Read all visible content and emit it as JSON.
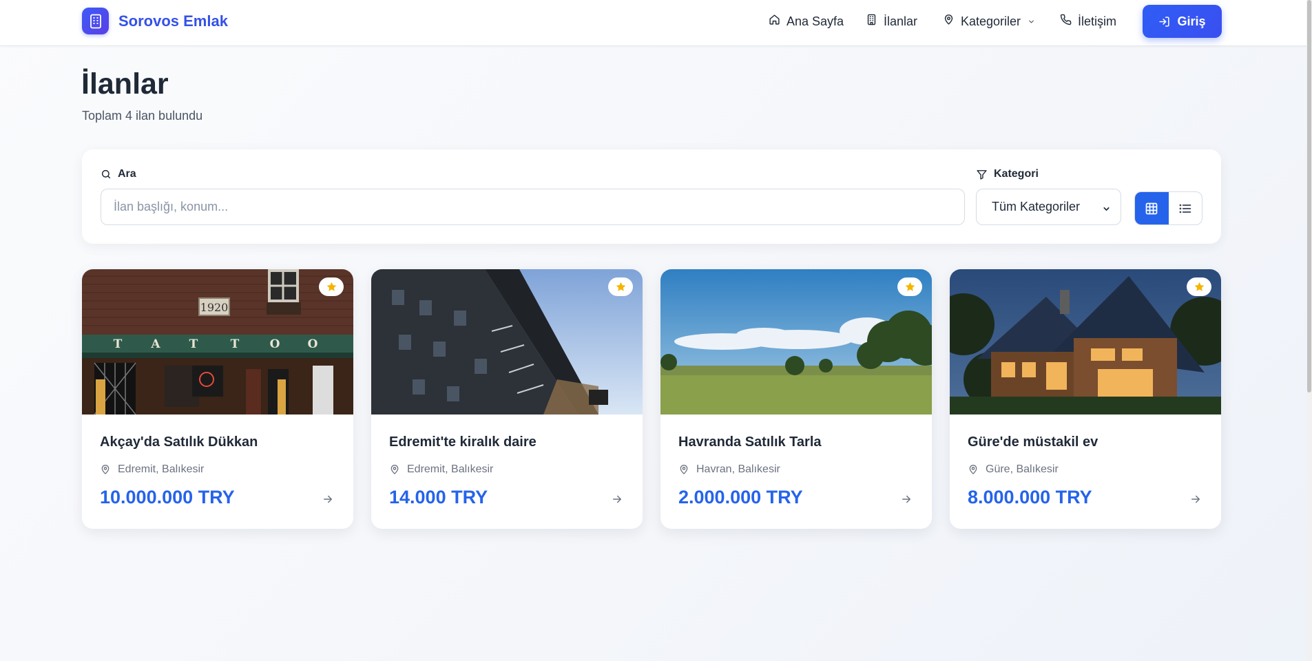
{
  "navbar": {
    "brand": "Sorovos Emlak",
    "links": [
      {
        "label": "Ana Sayfa",
        "icon": "home-icon"
      },
      {
        "label": "İlanlar",
        "icon": "building-icon"
      },
      {
        "label": "Kategoriler",
        "icon": "map-pin-icon"
      },
      {
        "label": "İletişim",
        "icon": "phone-icon"
      }
    ],
    "login_label": "Giriş"
  },
  "header": {
    "title": "İlanlar",
    "subtitle": "Toplam 4 ilan bulundu"
  },
  "filters": {
    "search_label": "Ara",
    "search_placeholder": "İlan başlığı, konum...",
    "search_value": "",
    "category_label": "Kategori",
    "category_selected": "Tüm Kategoriler",
    "view_mode": "grid"
  },
  "colors": {
    "brand": "#3451e8",
    "accent": "#2563eb",
    "star": "#f5b400"
  },
  "listings": [
    {
      "title": "Akçay'da Satılık Dükkan",
      "location": "Edremit, Balıkesir",
      "price": "10.000.000 TRY",
      "image": "tattoo-shop-storefront"
    },
    {
      "title": "Edremit'te kiralık daire",
      "location": "Edremit, Balıkesir",
      "price": "14.000 TRY",
      "image": "apartment-building"
    },
    {
      "title": "Havranda Satılık Tarla",
      "location": "Havran, Balıkesir",
      "price": "2.000.000 TRY",
      "image": "green-field"
    },
    {
      "title": "Güre'de müstakil ev",
      "location": "Güre, Balıkesir",
      "price": "8.000.000 TRY",
      "image": "wooden-house-night"
    }
  ]
}
